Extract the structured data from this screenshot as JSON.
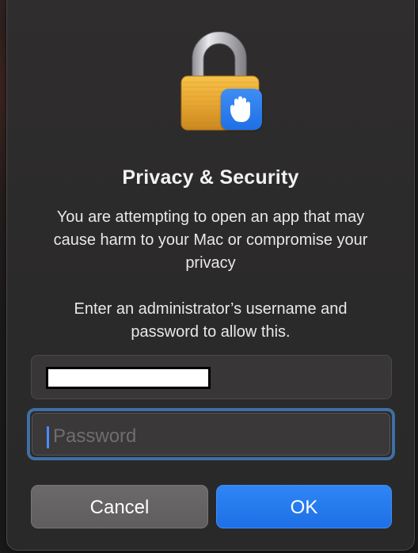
{
  "dialog": {
    "title": "Privacy & Security",
    "message": "You are attempting to open an app that may cause harm to your Mac or compromise your privacy",
    "instruction": "Enter an administrator’s username and password to allow this."
  },
  "icons": {
    "lock": "lock-icon",
    "hand": "hand-stop-icon",
    "badge_color": "#1f6fe6"
  },
  "fields": {
    "username": {
      "value": "",
      "redacted": true
    },
    "password": {
      "value": "",
      "placeholder": "Password",
      "focused": true
    }
  },
  "buttons": {
    "cancel_label": "Cancel",
    "ok_label": "OK"
  },
  "colors": {
    "accent": "#1f6fe6",
    "focus_ring": "#3f6fa3"
  }
}
